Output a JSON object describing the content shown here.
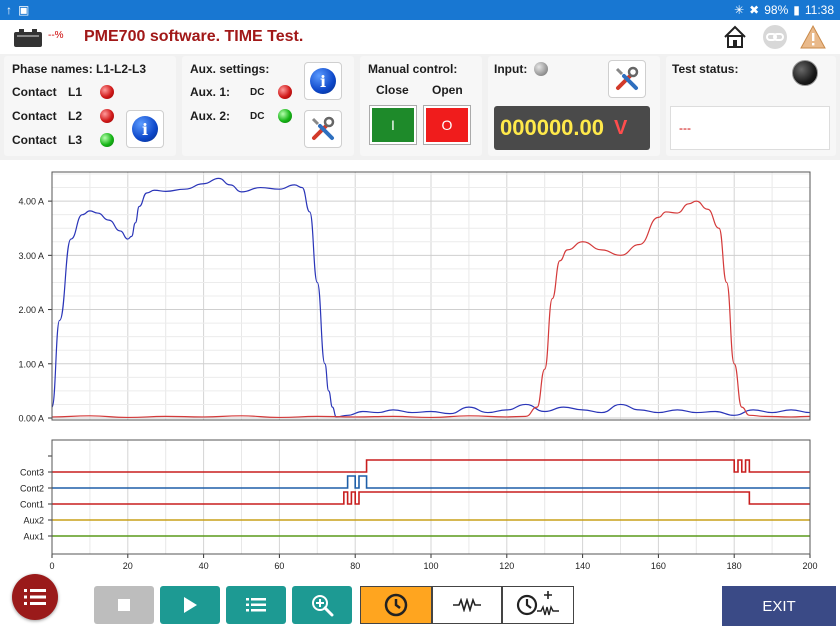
{
  "statusbar": {
    "battery": "98%",
    "time": "11:38"
  },
  "header": {
    "title": "PME700 software. TIME Test.",
    "battery_pct": "--%"
  },
  "phase": {
    "title": "Phase names: L1-L2-L3",
    "contacts": [
      {
        "label": "Contact",
        "name": "L1",
        "state": "red"
      },
      {
        "label": "Contact",
        "name": "L2",
        "state": "red"
      },
      {
        "label": "Contact",
        "name": "L3",
        "state": "green"
      }
    ]
  },
  "aux": {
    "title": "Aux. settings:",
    "items": [
      {
        "label": "Aux. 1:",
        "type": "DC",
        "state": "red"
      },
      {
        "label": "Aux. 2:",
        "type": "DC",
        "state": "green"
      }
    ]
  },
  "manual": {
    "title": "Manual control:",
    "close_label": "Close",
    "open_label": "Open",
    "close_btn": "I",
    "open_btn": "O"
  },
  "input": {
    "title": "Input:",
    "value": "000000.00",
    "unit": "V"
  },
  "test_status": {
    "title": "Test status:",
    "value": "---"
  },
  "chart_data": [
    {
      "type": "line",
      "x_range": [
        0,
        200
      ],
      "y_range": [
        0,
        4.5
      ],
      "y_ticks": [
        0,
        1,
        2,
        3,
        4
      ],
      "y_tick_labels": [
        "0.00 A",
        "1.00 A",
        "2.00 A",
        "3.00 A",
        "4.00 A"
      ],
      "grid": true,
      "series": [
        {
          "color": "#2a35b8",
          "x": [
            0,
            2,
            5,
            8,
            10,
            12,
            15,
            18,
            20,
            21,
            22,
            23,
            25,
            27,
            30,
            35,
            40,
            44,
            47,
            50,
            55,
            60,
            64,
            66,
            68,
            70,
            72,
            73,
            74,
            75,
            78,
            82,
            86,
            90,
            95,
            100,
            105,
            110,
            115,
            120,
            125,
            130,
            135,
            140,
            145,
            150,
            155,
            160,
            165,
            170,
            175,
            180,
            185,
            190,
            195,
            200
          ],
          "y": [
            0.2,
            1.8,
            3.3,
            3.75,
            3.82,
            3.78,
            3.65,
            3.45,
            3.3,
            3.35,
            3.6,
            3.9,
            4.15,
            4.2,
            4.18,
            4.22,
            4.32,
            4.42,
            4.3,
            4.17,
            4.25,
            4.22,
            4.3,
            4.25,
            3.8,
            2.5,
            1.0,
            0.5,
            0.2,
            0.02,
            0.05,
            0.12,
            0.1,
            0.15,
            0.1,
            0.12,
            0.08,
            0.2,
            0.1,
            0.15,
            0.25,
            0.12,
            0.2,
            0.15,
            0.1,
            0.25,
            0.15,
            0.1,
            0.15,
            0.1,
            0.12,
            0.05,
            0.15,
            0.1,
            0.15,
            0.1
          ]
        },
        {
          "color": "#d43a3a",
          "x": [
            0,
            10,
            20,
            30,
            40,
            50,
            60,
            70,
            80,
            90,
            100,
            110,
            120,
            125,
            128,
            130,
            132,
            134,
            136,
            140,
            145,
            150,
            155,
            160,
            162,
            165,
            168,
            170,
            173,
            176,
            178,
            180,
            182,
            184,
            188,
            195,
            200
          ],
          "y": [
            0.02,
            0.04,
            0.01,
            0.03,
            0.02,
            0.04,
            0.01,
            0.03,
            0.02,
            0.03,
            0.01,
            0.04,
            0.02,
            0.03,
            0.2,
            0.9,
            2.2,
            2.9,
            3.1,
            3.25,
            3.1,
            3.0,
            3.2,
            3.7,
            3.8,
            3.78,
            3.95,
            4.0,
            3.85,
            3.5,
            2.5,
            1.0,
            0.2,
            0.05,
            0.03,
            0.02,
            0.03
          ]
        }
      ]
    },
    {
      "type": "line",
      "x_range": [
        0,
        200
      ],
      "x_ticks": [
        0,
        20,
        40,
        60,
        80,
        100,
        120,
        140,
        160,
        180,
        200
      ],
      "channels": [
        "Cont3",
        "Cont2",
        "Cont1",
        "Aux2",
        "Aux1"
      ],
      "series": [
        {
          "name": "Cont3",
          "color": "#c81e1e",
          "x": [
            0,
            83,
            83,
            180,
            180,
            181,
            181,
            182,
            182,
            183,
            183,
            184,
            184,
            200
          ],
          "y": [
            0,
            0,
            1,
            1,
            0,
            0,
            1,
            1,
            0,
            0,
            1,
            1,
            0,
            0
          ]
        },
        {
          "name": "Cont2",
          "color": "#1f5fa8",
          "x": [
            0,
            78,
            78,
            80,
            80,
            81,
            81,
            83,
            83,
            184,
            184,
            200
          ],
          "y": [
            0,
            0,
            1,
            1,
            0,
            0,
            1,
            1,
            0,
            0,
            0,
            0
          ]
        },
        {
          "name": "Cont1",
          "color": "#c81e1e",
          "x": [
            0,
            77,
            77,
            78,
            78,
            79,
            79,
            80,
            80,
            81,
            81,
            184,
            184,
            200
          ],
          "y": [
            0,
            0,
            1,
            1,
            0,
            0,
            1,
            1,
            0,
            0,
            1,
            1,
            0,
            0
          ]
        },
        {
          "name": "Aux2",
          "color": "#c8a018",
          "x": [
            0,
            200
          ],
          "y": [
            0,
            0
          ]
        },
        {
          "name": "Aux1",
          "color": "#5a9a1a",
          "x": [
            0,
            200
          ],
          "y": [
            0,
            0
          ]
        }
      ]
    }
  ],
  "toolbar": {
    "exit_label": "EXIT"
  },
  "icons": {
    "home": "home-icon",
    "link": "link-icon",
    "warning": "warning-icon"
  }
}
